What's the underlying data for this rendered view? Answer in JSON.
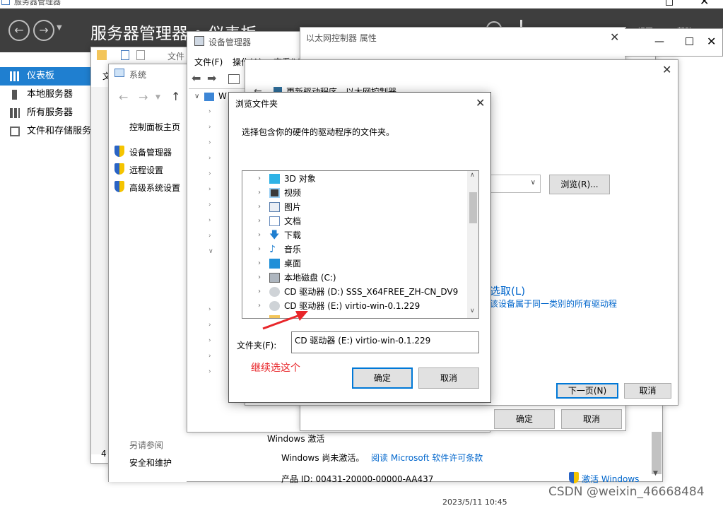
{
  "server_manager": {
    "window_title": "服务器管理器",
    "header_title": "服务器管理器 • 仪表板",
    "header_right": [
      "视图(V)",
      "帮助(H)"
    ],
    "nav": [
      {
        "label": "仪表板",
        "active": true
      },
      {
        "label": "本地服务器",
        "active": false
      },
      {
        "label": "所有服务器",
        "active": false
      },
      {
        "label": "文件和存储服务",
        "active": false
      }
    ],
    "bottom_number": "4"
  },
  "explorer_bg": {
    "tab_label": "文件",
    "menu_label": "文"
  },
  "system_window": {
    "title": "系统",
    "home_link": "控制面板主页",
    "links": [
      "设备管理器",
      "远程设置",
      "高级系统设置"
    ],
    "see_also_title": "另请参阅",
    "see_also_link": "安全和维护",
    "activation_section": "Windows 激活",
    "activation_status": "Windows 尚未激活。",
    "activation_link": "阅读 Microsoft 软件许可条款",
    "product_id": "产品 ID: 00431-20000-00000-AA437",
    "activate_link": "激活 Windows",
    "clock": "2023/5/11 10:45"
  },
  "device_manager": {
    "title": "设备管理器",
    "menu": [
      "文件(F)",
      "操作(A)",
      "查看(V)"
    ],
    "root_initial": "W"
  },
  "ethernet_props": {
    "title": "以太网控制器 属性",
    "ok": "确定",
    "cancel": "取消"
  },
  "update_driver": {
    "title": "更新驱动程序 - 以太网控制器",
    "browse_button": "浏览(R)...",
    "pick_link": "选取(L)",
    "pick_desc": "该设备属于同一类别的所有驱动程",
    "next_button": "下一页(N)",
    "cancel_button": "取消"
  },
  "browse_dialog": {
    "title": "浏览文件夹",
    "instruction": "选择包含你的硬件的驱动程序的文件夹。",
    "tree_items": [
      {
        "label": "3D 对象",
        "icon": "3d-objects-icon"
      },
      {
        "label": "视频",
        "icon": "video-folder-icon"
      },
      {
        "label": "图片",
        "icon": "pictures-folder-icon"
      },
      {
        "label": "文档",
        "icon": "documents-folder-icon"
      },
      {
        "label": "下载",
        "icon": "downloads-icon"
      },
      {
        "label": "音乐",
        "icon": "music-icon"
      },
      {
        "label": "桌面",
        "icon": "desktop-icon"
      },
      {
        "label": "本地磁盘 (C:)",
        "icon": "local-disk-icon"
      },
      {
        "label": "CD 驱动器 (D:) SSS_X64FREE_ZH-CN_DV9",
        "icon": "cd-drive-icon"
      },
      {
        "label": "CD 驱动器 (E:) virtio-win-0.1.229",
        "icon": "cd-drive-icon"
      }
    ],
    "folder_label": "文件夹(F):",
    "folder_value": "CD 驱动器 (E:) virtio-win-0.1.229",
    "ok": "确定",
    "cancel": "取消"
  },
  "annotation": {
    "text": "继续选这个",
    "color": "#e8262a"
  },
  "watermark": "CSDN @weixin_46668484",
  "colors": {
    "header_bg": "#3e3e3e",
    "accent": "#1f7fd0",
    "link": "#0066cc"
  }
}
